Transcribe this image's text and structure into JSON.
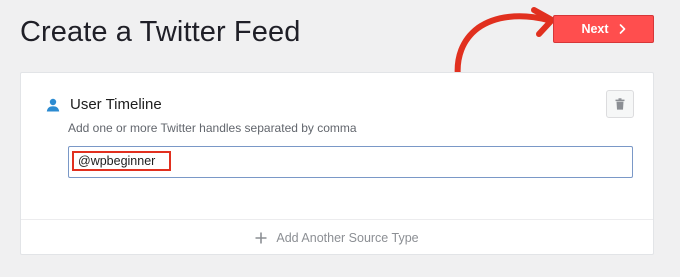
{
  "header": {
    "title": "Create a Twitter Feed",
    "next_label": "Next"
  },
  "source": {
    "title": "User Timeline",
    "helper": "Add one or more Twitter handles separated by comma",
    "handle_value": "@wpbeginner"
  },
  "footer": {
    "add_label": "Add Another Source Type"
  },
  "colors": {
    "next_button": "#ff4e4e",
    "annotation": "#e1301f",
    "user_icon": "#2c8bd1",
    "page_bg": "#f0f0f1"
  },
  "icons": {
    "next": "chevron-right-icon",
    "source": "user-icon",
    "delete": "trash-icon",
    "add": "plus-icon",
    "annotation": "hand-drawn-arrow"
  }
}
